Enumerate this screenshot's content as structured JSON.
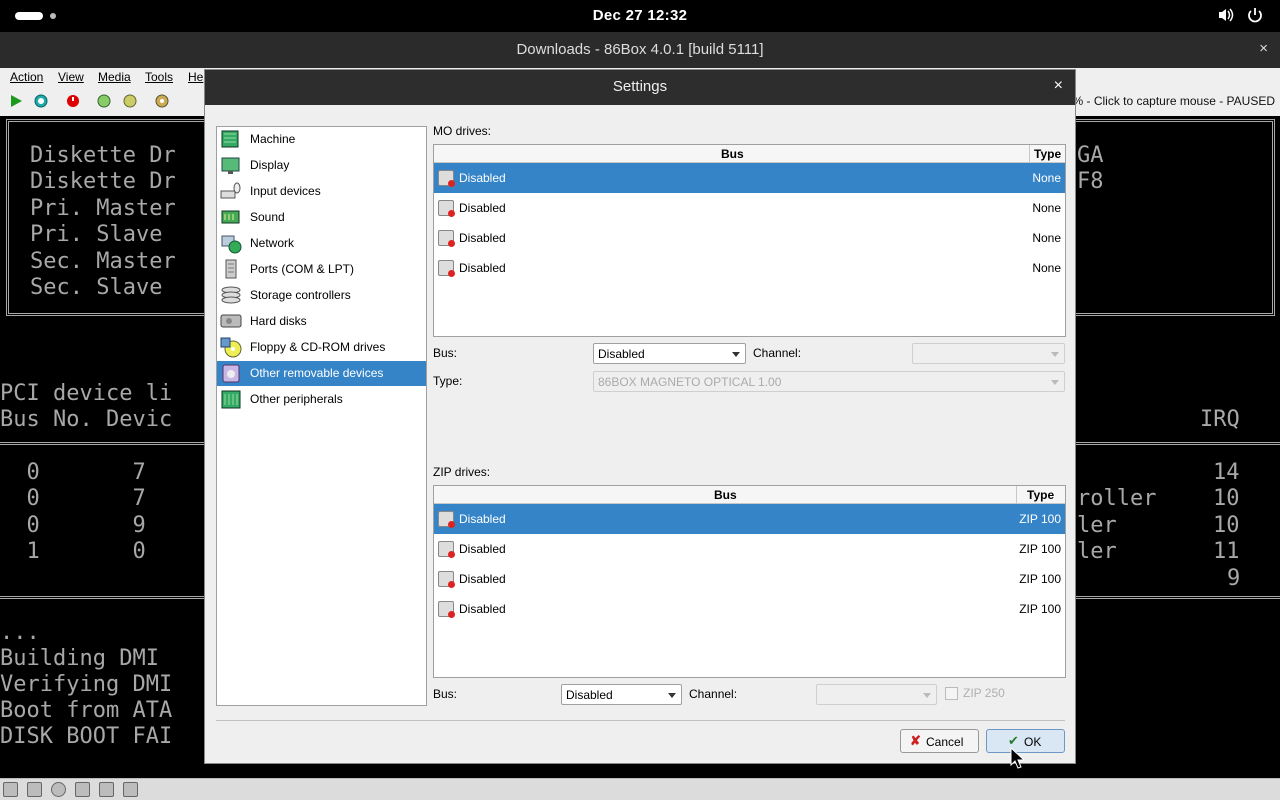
{
  "topbar": {
    "clock": "Dec 27  12:32",
    "volume_icon": "speaker-icon",
    "power_icon": "power-icon"
  },
  "window": {
    "title": "Downloads - 86Box 4.0.1 [build 5111]",
    "close": "×"
  },
  "menubar": {
    "items": [
      "Action",
      "View",
      "Media",
      "Tools",
      "He"
    ]
  },
  "toolbar": {
    "status": "% - Click to capture mouse - PAUSED"
  },
  "console": {
    "lines_left": [
      "Diskette Dr",
      "Diskette Dr",
      "Pri. Master",
      "Pri. Slave ",
      "Sec. Master",
      "Sec. Slave "
    ],
    "lines_right": [
      "GA",
      "F8"
    ],
    "pci_title": "PCI device li",
    "pci_header_left": "Bus No. Devic",
    "pci_header_right": "IRQ",
    "pci_rows_left": [
      "  0       7",
      "  0       7",
      "  0       9",
      "  1       0"
    ],
    "pci_rows_mid": [
      "",
      "roller",
      "ler",
      "ler",
      ""
    ],
    "pci_rows_irq": [
      "14",
      "10",
      "10",
      "11",
      "9"
    ],
    "boot_lines": [
      "...",
      "Building DMI",
      "Verifying DMI",
      "Boot from ATA",
      "DISK BOOT FAI"
    ]
  },
  "dialog": {
    "title": "Settings",
    "close": "×",
    "nav": [
      {
        "label": "Machine",
        "icon": "machine-icon"
      },
      {
        "label": "Display",
        "icon": "display-icon"
      },
      {
        "label": "Input devices",
        "icon": "input-devices-icon"
      },
      {
        "label": "Sound",
        "icon": "sound-icon"
      },
      {
        "label": "Network",
        "icon": "network-icon"
      },
      {
        "label": "Ports (COM & LPT)",
        "icon": "ports-icon"
      },
      {
        "label": "Storage controllers",
        "icon": "storage-controllers-icon"
      },
      {
        "label": "Hard disks",
        "icon": "hard-disks-icon"
      },
      {
        "label": "Floppy & CD-ROM drives",
        "icon": "floppy-cdrom-icon"
      },
      {
        "label": "Other removable devices",
        "icon": "removable-devices-icon"
      },
      {
        "label": "Other peripherals",
        "icon": "peripherals-icon"
      }
    ],
    "mo": {
      "label": "MO drives:",
      "col_bus": "Bus",
      "col_type": "Type",
      "rows": [
        {
          "bus": "Disabled",
          "type": "None"
        },
        {
          "bus": "Disabled",
          "type": "None"
        },
        {
          "bus": "Disabled",
          "type": "None"
        },
        {
          "bus": "Disabled",
          "type": "None"
        }
      ],
      "bus_label": "Bus:",
      "bus_value": "Disabled",
      "channel_label": "Channel:",
      "channel_value": "",
      "type_label": "Type:",
      "type_value": "86BOX MAGNETO OPTICAL 1.00"
    },
    "zip": {
      "label": "ZIP drives:",
      "col_bus": "Bus",
      "col_type": "Type",
      "rows": [
        {
          "bus": "Disabled",
          "type": "ZIP 100"
        },
        {
          "bus": "Disabled",
          "type": "ZIP 100"
        },
        {
          "bus": "Disabled",
          "type": "ZIP 100"
        },
        {
          "bus": "Disabled",
          "type": "ZIP 100"
        }
      ],
      "bus_label": "Bus:",
      "bus_value": "Disabled",
      "channel_label": "Channel:",
      "channel_value": "",
      "zip250_label": "ZIP 250"
    },
    "buttons": {
      "cancel": "Cancel",
      "ok": "OK"
    }
  },
  "colors": {
    "selection": "#3584c8",
    "dialog_bg": "#efefef",
    "titlebar": "#2d2d2d"
  }
}
